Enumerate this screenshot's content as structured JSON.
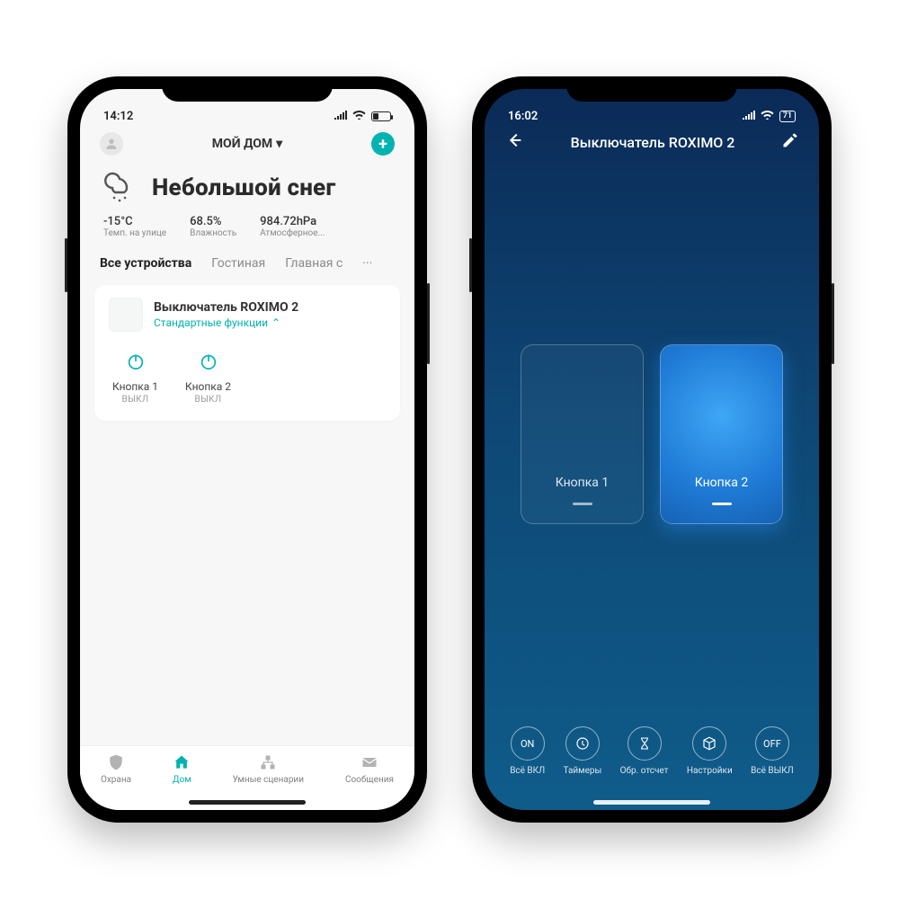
{
  "left": {
    "status_time": "14:12",
    "home_title": "МОЙ ДОМ",
    "weather": {
      "title": "Небольшой снег",
      "temp_value": "-15°C",
      "temp_label": "Темп. на улице",
      "humidity_value": "68.5%",
      "humidity_label": "Влажность",
      "pressure_value": "984.72hPa",
      "pressure_label": "Атмосферное..."
    },
    "tabs": {
      "t0": "Все устройства",
      "t1": "Гостиная",
      "t2": "Главная с",
      "dots": "···"
    },
    "device": {
      "name": "Выключатель ROXIMO 2",
      "sub": "Стандартные функции",
      "btn1_label": "Кнопка 1",
      "btn1_state": "ВЫКЛ",
      "btn2_label": "Кнопка 2",
      "btn2_state": "ВЫКЛ"
    },
    "nav": {
      "n0": "Охрана",
      "n1": "Дом",
      "n2": "Умные сценарии",
      "n3": "Сообщения"
    }
  },
  "right": {
    "status_time": "16:02",
    "battery_text": "71",
    "title": "Выключатель ROXIMO 2",
    "switch1": "Кнопка 1",
    "switch2": "Кнопка 2",
    "bottom": {
      "b0_icon": "ON",
      "b0": "Всё ВКЛ",
      "b1": "Таймеры",
      "b2": "Обр. отсчет",
      "b3": "Настройки",
      "b4_icon": "OFF",
      "b4": "Всё ВЫКЛ"
    }
  }
}
